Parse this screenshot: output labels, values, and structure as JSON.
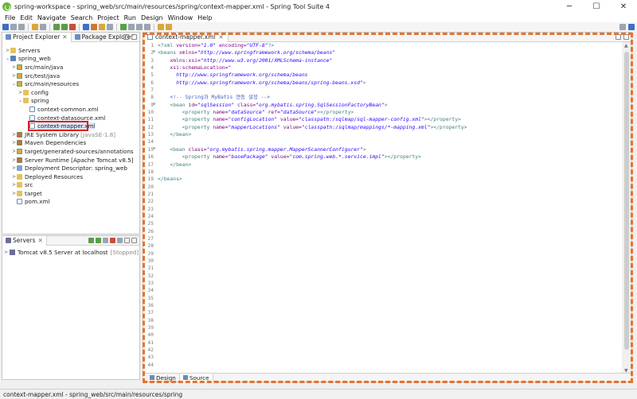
{
  "window": {
    "title": "spring-workspace - spring_web/src/main/resources/spring/context-mapper.xml - Spring Tool Suite 4",
    "minimize": "─",
    "maximize": "☐",
    "close": "✕"
  },
  "menu": [
    "File",
    "Edit",
    "Navigate",
    "Search",
    "Project",
    "Run",
    "Design",
    "Window",
    "Help"
  ],
  "left_panel": {
    "tabs": [
      "Project Explorer",
      "Package Explorer"
    ],
    "tab_close": "✕",
    "tree": [
      {
        "label": "Servers",
        "arrow": ">",
        "icon": "folder-icon"
      },
      {
        "label": "spring_web",
        "arrow": "⌄",
        "icon": "project-icon"
      },
      {
        "label": "src/main/java",
        "arrow": ">",
        "icon": "source-folder-icon"
      },
      {
        "label": "src/test/java",
        "arrow": ">",
        "icon": "source-folder-icon"
      },
      {
        "label": "src/main/resources",
        "arrow": "⌄",
        "icon": "source-folder-icon"
      },
      {
        "label": "config",
        "arrow": ">",
        "icon": "folder-icon"
      },
      {
        "label": "spring",
        "arrow": "⌄",
        "icon": "folder-icon"
      },
      {
        "label": "context-common.xml",
        "arrow": "",
        "icon": "xml-file-icon"
      },
      {
        "label": "context-datasource.xml",
        "arrow": "",
        "icon": "xml-file-icon"
      },
      {
        "label": "context-mapper.xml",
        "arrow": "",
        "icon": "xml-file-icon"
      },
      {
        "label": "JRE System Library",
        "suffix": "[JavaSE-1.8]",
        "arrow": ">",
        "icon": "library-icon"
      },
      {
        "label": "Maven Dependencies",
        "arrow": ">",
        "icon": "library-icon"
      },
      {
        "label": "target/generated-sources/annotations",
        "arrow": ">",
        "icon": "source-folder-icon"
      },
      {
        "label": "Server Runtime [Apache Tomcat v8.5]",
        "arrow": ">",
        "icon": "library-icon"
      },
      {
        "label": "Deployment Descriptor: spring_web",
        "arrow": ">",
        "icon": "descriptor-icon"
      },
      {
        "label": "Deployed Resources",
        "arrow": ">",
        "icon": "folder-icon"
      },
      {
        "label": "src",
        "arrow": ">",
        "icon": "folder-icon"
      },
      {
        "label": "target",
        "arrow": ">",
        "icon": "folder-icon"
      },
      {
        "label": "pom.xml",
        "arrow": "",
        "icon": "xml-file-icon"
      }
    ]
  },
  "servers_panel": {
    "tab": "Servers",
    "tab_close": "✕",
    "server_name": "Tomcat v8.5 Server at localhost",
    "server_status": "[Stopped]",
    "arrow": ">"
  },
  "editor": {
    "tab_label": "context-mapper.xml",
    "tab_close": "✕",
    "bottom_tabs": [
      "Design",
      "Source"
    ],
    "code_lines": [
      [
        {
          "t": "<?xml",
          "c": "t-pi"
        },
        {
          "t": " version=",
          "c": "t-att"
        },
        {
          "t": "\"1.0\"",
          "c": "t-val"
        },
        {
          "t": " encoding=",
          "c": "t-att"
        },
        {
          "t": "\"UTF-8\"",
          "c": "t-val"
        },
        {
          "t": "?>",
          "c": "t-pi"
        }
      ],
      [
        {
          "t": "<beans",
          "c": "t-tag"
        },
        {
          "t": " xmlns=",
          "c": "t-att"
        },
        {
          "t": "\"http://www.springframework.org/schema/beans\"",
          "c": "t-val"
        }
      ],
      [
        {
          "t": "    xmlns:xsi=",
          "c": "t-att"
        },
        {
          "t": "\"http://www.w3.org/2001/XMLSchema-instance\"",
          "c": "t-val"
        }
      ],
      [
        {
          "t": "    xsi:schemaLocation=",
          "c": "t-att"
        },
        {
          "t": "\"",
          "c": "t-val"
        }
      ],
      [
        {
          "t": "      http://www.springframework.org/schema/beans",
          "c": "t-val"
        }
      ],
      [
        {
          "t": "      http://www.springframework.org/schema/beans/spring-beans.xsd\"",
          "c": "t-val"
        },
        {
          "t": ">",
          "c": "t-tag"
        }
      ],
      [
        {
          "t": "",
          "c": ""
        }
      ],
      [
        {
          "t": "    <!-- Spring과 MyBatis 연동 설정 -->",
          "c": "t-cmt"
        }
      ],
      [
        {
          "t": "    <bean",
          "c": "t-tag"
        },
        {
          "t": " id=",
          "c": "t-att"
        },
        {
          "t": "\"sqlSession\"",
          "c": "t-val"
        },
        {
          "t": " class=",
          "c": "t-att"
        },
        {
          "t": "\"org.mybatis.spring.SqlSessionFactoryBean\"",
          "c": "t-val"
        },
        {
          "t": ">",
          "c": "t-tag"
        }
      ],
      [
        {
          "t": "        <property",
          "c": "t-tag"
        },
        {
          "t": " name=",
          "c": "t-att"
        },
        {
          "t": "\"dataSource\"",
          "c": "t-val"
        },
        {
          "t": " ref=",
          "c": "t-att"
        },
        {
          "t": "\"dataSource\"",
          "c": "t-val"
        },
        {
          "t": "></property>",
          "c": "t-tag"
        }
      ],
      [
        {
          "t": "        <property",
          "c": "t-tag"
        },
        {
          "t": " name=",
          "c": "t-att"
        },
        {
          "t": "\"configLocation\"",
          "c": "t-val"
        },
        {
          "t": " value=",
          "c": "t-att"
        },
        {
          "t": "\"classpath:/sqlmap/sql-mapper-config.xml\"",
          "c": "t-val"
        },
        {
          "t": "></property>",
          "c": "t-tag"
        }
      ],
      [
        {
          "t": "        <property",
          "c": "t-tag"
        },
        {
          "t": " name=",
          "c": "t-att"
        },
        {
          "t": "\"mapperLocations\"",
          "c": "t-val"
        },
        {
          "t": " value=",
          "c": "t-att"
        },
        {
          "t": "\"classpath:/sqlmap/mappings/*-mapping.xml\"",
          "c": "t-val"
        },
        {
          "t": "></property>",
          "c": "t-tag"
        }
      ],
      [
        {
          "t": "    </bean>",
          "c": "t-tag"
        }
      ],
      [
        {
          "t": "",
          "c": ""
        }
      ],
      [
        {
          "t": "    <bean",
          "c": "t-tag"
        },
        {
          "t": " class=",
          "c": "t-att"
        },
        {
          "t": "\"org.mybatis.spring.mapper.MapperScannerConfigurer\"",
          "c": "t-val"
        },
        {
          "t": ">",
          "c": "t-tag"
        }
      ],
      [
        {
          "t": "        <property",
          "c": "t-tag"
        },
        {
          "t": " name=",
          "c": "t-att"
        },
        {
          "t": "\"basePackage\"",
          "c": "t-val"
        },
        {
          "t": " value=",
          "c": "t-att"
        },
        {
          "t": "\"com.spring.web.*.service.impl\"",
          "c": "t-val"
        },
        {
          "t": "></property>",
          "c": "t-tag"
        }
      ],
      [
        {
          "t": "    </bean>",
          "c": "t-tag"
        }
      ],
      [
        {
          "t": "",
          "c": ""
        }
      ],
      [
        {
          "t": "</beans>",
          "c": "t-tag"
        }
      ]
    ],
    "total_lines": 44,
    "fold_lines": [
      2,
      9,
      15
    ]
  },
  "status_bar": {
    "text": "context-mapper.xml - spring_web/src/main/resources/spring"
  },
  "colors": {
    "highlight_red": "#e01b1b",
    "annotation_orange": "#e8722a"
  }
}
